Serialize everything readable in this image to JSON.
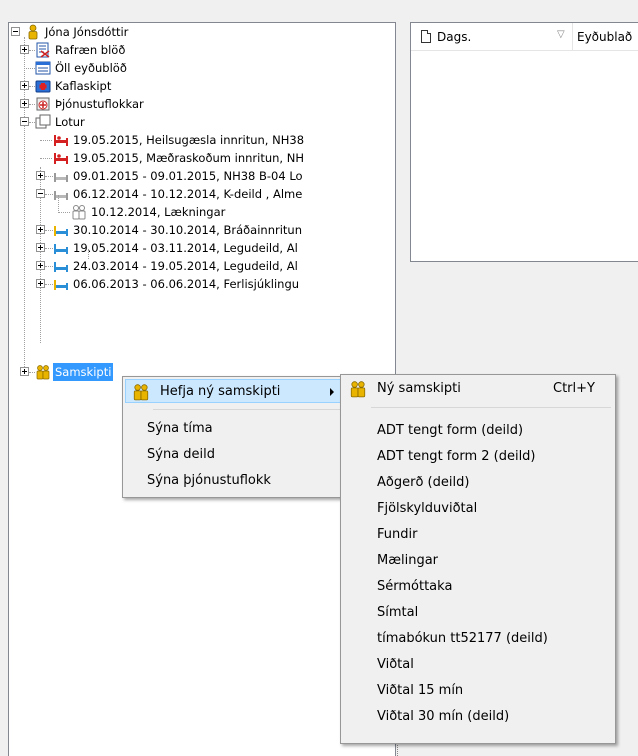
{
  "tree": {
    "root": "Jóna Jónsdóttir",
    "nodes": [
      {
        "label": "Rafræn blöð",
        "icon": "edoc-icon"
      },
      {
        "label": "Öll eyðublöð",
        "icon": "forms-icon"
      },
      {
        "label": "Kaflaskipt",
        "icon": "medkit-icon"
      },
      {
        "label": "Þjónustuflokkar",
        "icon": "service-icon"
      },
      {
        "label": "Lotur",
        "icon": "folder-icon"
      },
      {
        "label": "19.05.2015, Heilsugæsla innritun, NH38",
        "icon": "bed-red-icon"
      },
      {
        "label": "19.05.2015, Mæðraskoðum innritun, NH",
        "icon": "bed-red-icon"
      },
      {
        "label": "09.01.2015 - 09.01.2015, NH38 B-04 Lo",
        "icon": "bed-gray-icon"
      },
      {
        "label": "06.12.2014 - 10.12.2014, K-deild , Alme",
        "icon": "bed-gray-icon"
      },
      {
        "label": "10.12.2014, Lækningar",
        "icon": "people-gray-icon"
      },
      {
        "label": "30.10.2014 - 30.10.2014, Bráðainnritun",
        "icon": "bed-blue-icon"
      },
      {
        "label": "19.05.2014 - 03.11.2014, Legudeild, Al",
        "icon": "bed-blue-icon"
      },
      {
        "label": "24.03.2014 - 19.05.2014, Legudeild, Al",
        "icon": "bed-blue-icon"
      },
      {
        "label": "06.06.2013 - 06.06.2014, Ferlisjúklingu",
        "icon": "bed-blue-icon"
      },
      {
        "label": "Samskipti",
        "icon": "people-icon"
      }
    ]
  },
  "list": {
    "columns": [
      "Dags.",
      "Eyðublað"
    ],
    "filter_glyph": "▽"
  },
  "context_menu": {
    "items": [
      "Hefja ný samskipti",
      "Sýna tíma",
      "Sýna deild",
      "Sýna þjónustuflokk"
    ]
  },
  "submenu": {
    "new_item": "Ný samskipti",
    "shortcut": "Ctrl+Y",
    "items": [
      "ADT tengt form (deild)",
      "ADT tengt form 2 (deild)",
      "Aðgerð (deild)",
      "Fjölskylduviðtal",
      "Fundir",
      "Mælingar",
      "Sérmóttaka",
      "Símtal",
      "tímabókun tt52177 (deild)",
      "Viðtal",
      "Viðtal 15 mín",
      "Viðtal 30 mín (deild)"
    ]
  },
  "colors": {
    "selection": "#3399ff",
    "menu_highlight": "#cce8ff",
    "bed_red": "#d42020",
    "bed_blue": "#2a8fd6",
    "person_yellow": "#e8b400"
  }
}
